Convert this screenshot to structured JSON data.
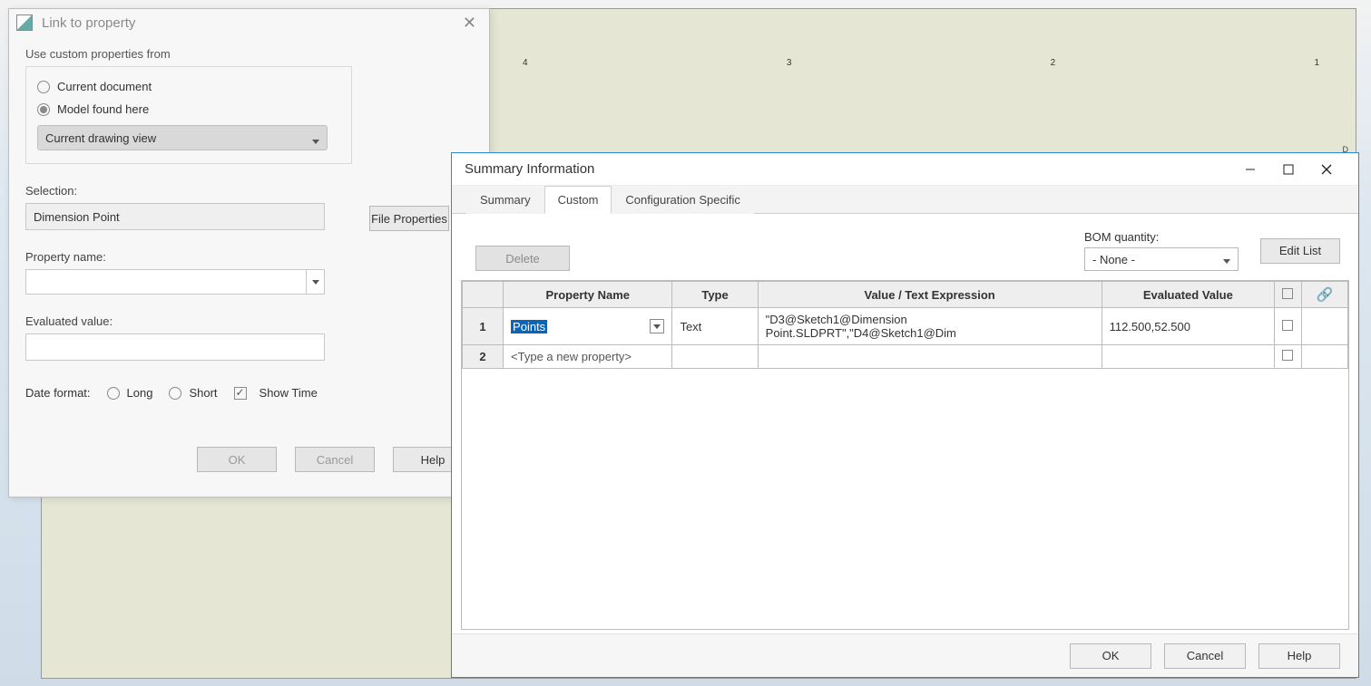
{
  "link_dialog": {
    "title": "Link to property",
    "close_glyph": "✕",
    "group_label": "Use custom properties from",
    "radio_current_doc": "Current document",
    "radio_model_found": "Model found here",
    "combo_value": "Current drawing view",
    "selection_label": "Selection:",
    "selection_value": "Dimension Point",
    "property_name_label": "Property name:",
    "evaluated_value_label": "Evaluated value:",
    "date_format_label": "Date format:",
    "long_label": "Long",
    "short_label": "Short",
    "show_time_label": "Show Time",
    "file_properties_btn": "File Properties",
    "ok": "OK",
    "cancel": "Cancel",
    "help": "Help"
  },
  "summary_dialog": {
    "title": "Summary Information",
    "tabs": {
      "summary": "Summary",
      "custom": "Custom",
      "config": "Configuration Specific"
    },
    "delete_btn": "Delete",
    "bom_label": "BOM quantity:",
    "bom_value": "- None -",
    "edit_list_btn": "Edit List",
    "headers": {
      "property_name": "Property Name",
      "type": "Type",
      "value": "Value / Text Expression",
      "evaluated": "Evaluated Value"
    },
    "rows": [
      {
        "num": "1",
        "name": "Points",
        "type": "Text",
        "value": "\"D3@Sketch1@Dimension Point.SLDPRT\",\"D4@Sketch1@Dim",
        "evaluated": "112.500,52.500"
      },
      {
        "num": "2",
        "name_placeholder": "<Type a new property>"
      }
    ],
    "ok": "OK",
    "cancel": "Cancel",
    "help": "Help"
  },
  "ruler": {
    "t4": "4",
    "t3": "3",
    "t2": "2",
    "t1": "1",
    "axis_d": "D"
  }
}
